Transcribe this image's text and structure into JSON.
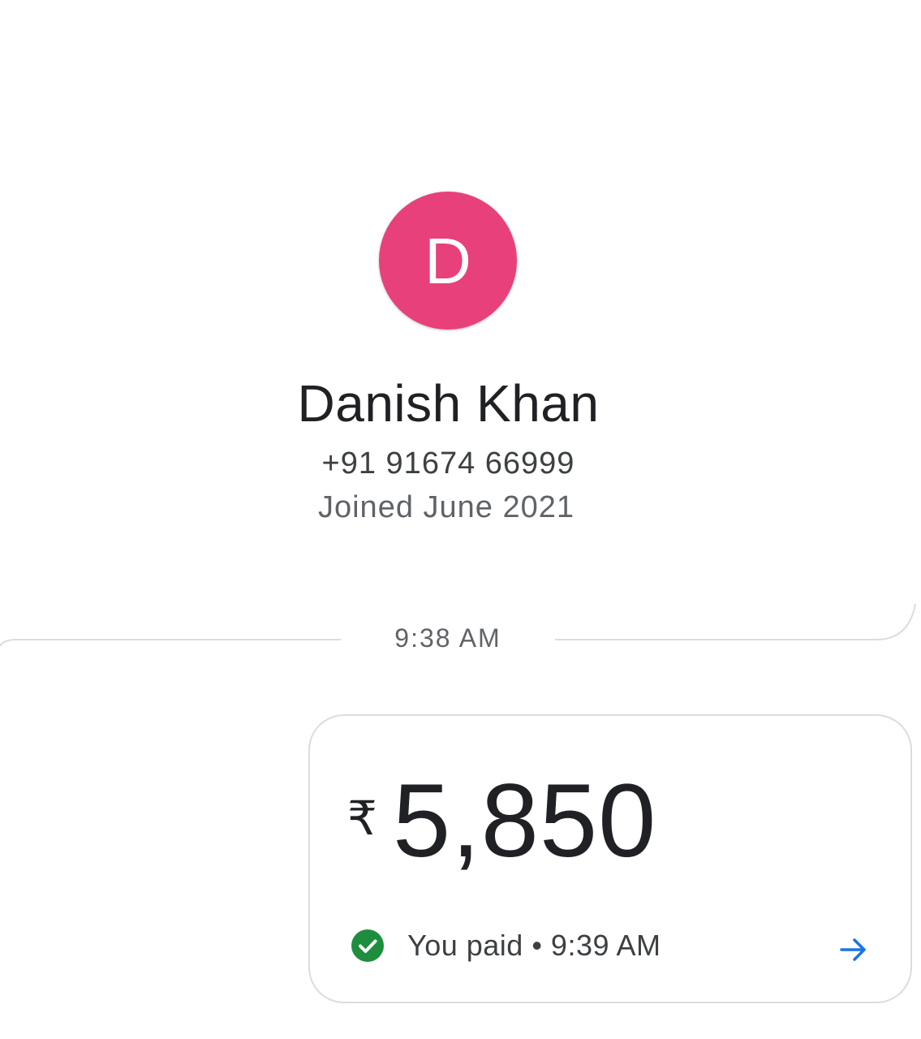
{
  "contact": {
    "avatar_letter": "D",
    "avatar_color": "#e8407a",
    "name": "Danish Khan",
    "phone": "+91 91674 66999",
    "joined": "Joined June 2021"
  },
  "timeline": {
    "separator_time": "9:38 AM"
  },
  "payment": {
    "currency_symbol": "₹",
    "amount": "5,850",
    "status_text": "You paid • 9:39 AM",
    "status_icon": "check-circle-icon",
    "status_color": "#1e8e3e",
    "action_icon": "arrow-right-icon",
    "action_color": "#1a73e8"
  }
}
